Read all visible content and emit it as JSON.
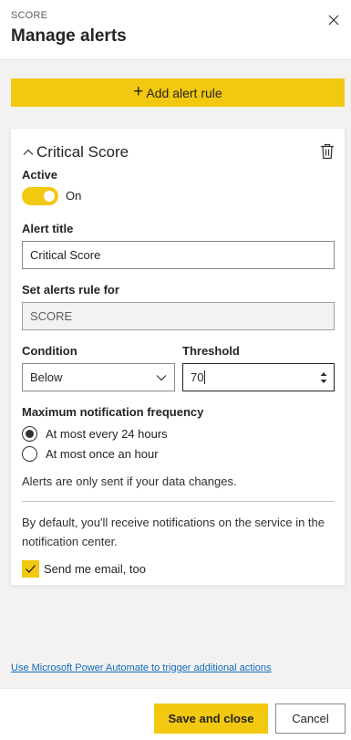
{
  "header": {
    "subtitle": "SCORE",
    "title": "Manage alerts"
  },
  "actions": {
    "add_rule": "Add alert rule"
  },
  "rule": {
    "name": "Critical Score",
    "active_label": "Active",
    "toggle_state": "On",
    "alert_title_label": "Alert title",
    "alert_title_value": "Critical Score",
    "rule_for_label": "Set alerts rule for",
    "rule_for_value": "SCORE",
    "condition_label": "Condition",
    "condition_value": "Below",
    "threshold_label": "Threshold",
    "threshold_value": "70",
    "frequency_label": "Maximum notification frequency",
    "frequency_options": [
      "At most every 24 hours",
      "At most once an hour"
    ],
    "frequency_selected": 0,
    "data_note": "Alerts are only sent if your data changes.",
    "default_note": "By default, you'll receive notifications on the service in the notification center.",
    "email_label": "Send me email, too",
    "email_checked": true
  },
  "link": {
    "automate": "Use Microsoft Power Automate to trigger additional actions"
  },
  "footer": {
    "save": "Save and close",
    "cancel": "Cancel"
  },
  "colors": {
    "accent": "#f2c811",
    "link": "#0f6cbd"
  }
}
